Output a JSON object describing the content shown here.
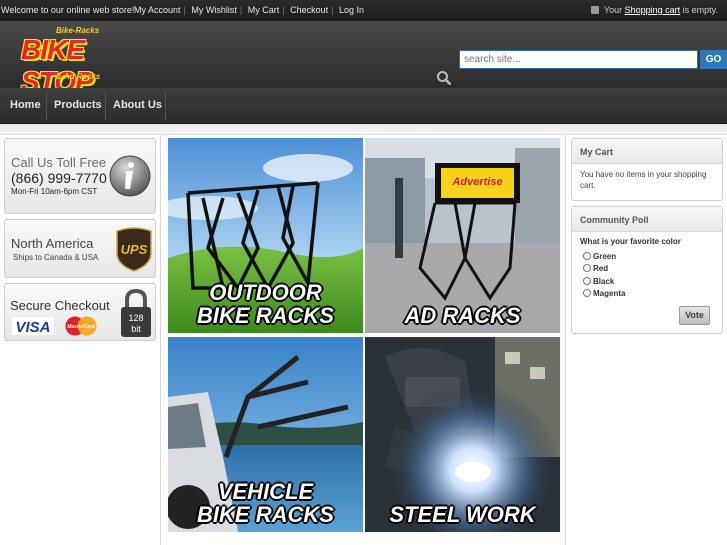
{
  "topbar": {
    "welcome": "Welcome to our online web store!",
    "links": [
      "My Account",
      "My Wishlist",
      "My Cart",
      "Checkout",
      "Log In"
    ],
    "cart_prefix": "Your",
    "cart_link": "Shopping cart",
    "cart_suffix": "is empty."
  },
  "logo": {
    "top": "Bike-Racks",
    "main": "BIKE STOP",
    "bottom": "& Ad Racks"
  },
  "search": {
    "placeholder": "search site...",
    "button": "GO"
  },
  "nav": {
    "items": [
      "Home",
      "Products",
      "About Us"
    ]
  },
  "left": {
    "call": {
      "title": "Call Us Toll Free",
      "phone": "(866) 999-7770",
      "hours": "Mon-Fri 10am-6pm CST"
    },
    "ship": {
      "title": "North America",
      "subtitle": "Ships to Canada & USA",
      "logo_text": "UPS"
    },
    "secure": {
      "title": "Secure Checkout",
      "visa": "VISA",
      "mastercard": "MasterCard",
      "bits": "128",
      "bits_label": "bit"
    }
  },
  "tiles": [
    {
      "line1": "OUTDOOR",
      "line2": "BIKE RACKS"
    },
    {
      "line1": "",
      "line2": "AD RACKS",
      "sign": "Advertise"
    },
    {
      "line1": "VEHICLE",
      "line2": "BIKE RACKS"
    },
    {
      "line1": "",
      "line2": "STEEL WORK"
    }
  ],
  "cart": {
    "title": "My Cart",
    "message": "You have no items in your shopping cart."
  },
  "poll": {
    "title": "Community Poll",
    "question": "What is your favorite color",
    "options": [
      "Green",
      "Red",
      "Black",
      "Magenta"
    ],
    "vote": "Vote"
  },
  "colors": {
    "brand_red": "#e8242a",
    "brand_yellow": "#f5e61c",
    "accent_blue": "#2e78b8"
  }
}
